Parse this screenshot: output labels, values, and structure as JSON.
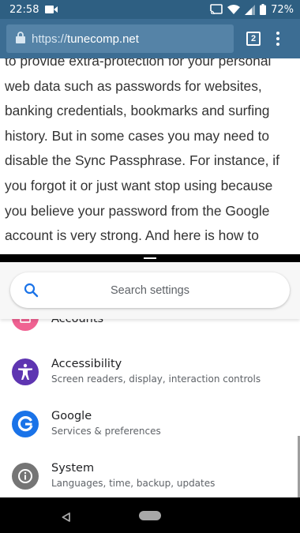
{
  "status_bar": {
    "time": "22:58",
    "battery": "72%",
    "icons": [
      "video-icon",
      "cast-icon",
      "wifi-icon",
      "signal-icon",
      "battery-icon"
    ]
  },
  "browser": {
    "url_scheme": "https://",
    "url_host": "tunecomp.net",
    "tab_count": "2",
    "icons": [
      "lock-icon",
      "more-vert-icon"
    ]
  },
  "article": {
    "text": "to provide extra-protection for your personal web data such as passwords for websites, banking credentials, bookmarks and surfing history. But in some cases you may need to disable the Sync Passphrase. For instance, if you forgot it or just want stop using because you believe your password from the Google account is very strong. And here is how to"
  },
  "settings": {
    "search_placeholder": "Search settings",
    "items": [
      {
        "title": "Accounts",
        "subtitle": "",
        "icon": "accounts-icon",
        "color": "#f06292"
      },
      {
        "title": "Accessibility",
        "subtitle": "Screen readers, display, interaction controls",
        "icon": "accessibility-icon",
        "color": "#5e35b1"
      },
      {
        "title": "Google",
        "subtitle": "Services & preferences",
        "icon": "google-icon",
        "color": "#1a73e8"
      },
      {
        "title": "System",
        "subtitle": "Languages, time, backup, updates",
        "icon": "info-icon",
        "color": "#757575"
      }
    ]
  },
  "colors": {
    "status_bar": "#2e5f82",
    "toolbar": "#3c6d93",
    "search_icon": "#1a73e8"
  }
}
